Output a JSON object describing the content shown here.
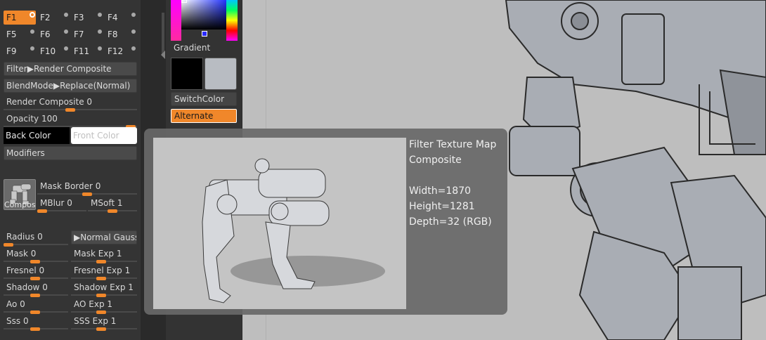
{
  "function_keys": [
    "F1",
    "F2",
    "F3",
    "F4",
    "F5",
    "F6",
    "F7",
    "F8",
    "F9",
    "F10",
    "F11",
    "F12"
  ],
  "active_key": "F1",
  "filter_button": "Filter▶Render Composite",
  "blendmode_button": "BlendMode▶Replace(Normal)",
  "render_composite": {
    "label": "Render Composite",
    "value": "0"
  },
  "opacity": {
    "label": "Opacity",
    "value": "100"
  },
  "back_color_label": "Back Color",
  "front_color_label": "Front Color",
  "modifiers_label": "Modifiers",
  "thumbnail_caption": "Compos",
  "mask_border": {
    "label": "Mask Border",
    "value": "0"
  },
  "mblur": {
    "label": "MBlur",
    "value": "0"
  },
  "msoft": {
    "label": "MSoft",
    "value": "1"
  },
  "radius": {
    "label": "Radius",
    "value": "0"
  },
  "normal_gauss": "▶Normal Gauss",
  "mask": {
    "label": "Mask",
    "value": "0"
  },
  "mask_exp": {
    "label": "Mask Exp",
    "value": "1"
  },
  "fresnel": {
    "label": "Fresnel",
    "value": "0"
  },
  "fresnel_exp": {
    "label": "Fresnel Exp",
    "value": "1"
  },
  "shadow": {
    "label": "Shadow",
    "value": "0"
  },
  "shadow_exp": {
    "label": "Shadow Exp",
    "value": "1"
  },
  "ao": {
    "label": "Ao",
    "value": "0"
  },
  "ao_exp": {
    "label": "AO Exp",
    "value": "1"
  },
  "sss": {
    "label": "Sss",
    "value": "0"
  },
  "sss_exp": {
    "label": "SSS Exp",
    "value": "1"
  },
  "gradient_label": "Gradient",
  "switch_color_label": "SwitchColor",
  "alternate_label": "Alternate",
  "tooltip": {
    "title_line1": "Filter Texture Map",
    "title_line2": "Composite",
    "width": "Width=1870",
    "height": "Height=1281",
    "depth": "Depth=32 (RGB)"
  },
  "colors": {
    "accent": "#f0872a",
    "panel": "#343434",
    "canvas": "#bebebe"
  }
}
